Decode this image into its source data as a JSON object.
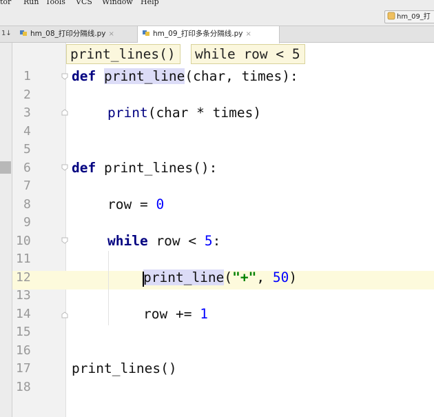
{
  "menu": {
    "items": [
      "tor",
      "Run",
      "Tools",
      "VCS",
      "Window",
      "Help"
    ]
  },
  "navbar": {
    "file_tab": "hm_09_打"
  },
  "tabs": [
    {
      "label": "hm_08_打印分隔线.py",
      "close": "×",
      "active": false
    },
    {
      "label": "hm_09_打印多条分隔线.py",
      "close": "×",
      "active": true
    }
  ],
  "tab_edge": "1↓",
  "breadcrumb": [
    "print_lines()",
    "while row < 5"
  ],
  "line_numbers": [
    "1",
    "2",
    "3",
    "4",
    "5",
    "6",
    "7",
    "8",
    "9",
    "10",
    "11",
    "12",
    "13",
    "14",
    "15",
    "16",
    "17",
    "18"
  ],
  "code": {
    "l1_kw": "def",
    "l1_fn": "print_line",
    "l1_rest": "(char, times):",
    "l3_fn": "print",
    "l3_rest": "(char * times)",
    "l6_kw": "def",
    "l6_rest": " print_lines():",
    "l8_pre": "row = ",
    "l8_num": "0",
    "l10_kw": "while",
    "l10_mid": " row < ",
    "l10_num": "5",
    "l10_end": ":",
    "l12_fn": "print_line",
    "l12_open": "(",
    "l12_str": "\"+\"",
    "l12_comma": ", ",
    "l12_num": "50",
    "l12_close": ")",
    "l14_pre": "row += ",
    "l14_num": "1",
    "l17": "print_lines()"
  },
  "current_line": 12,
  "colors": {
    "keyword": "#000080",
    "number": "#0000ff",
    "string": "#008000",
    "current_line_bg": "#fdfadc",
    "breadcrumb_bg": "#fbf7dd"
  }
}
